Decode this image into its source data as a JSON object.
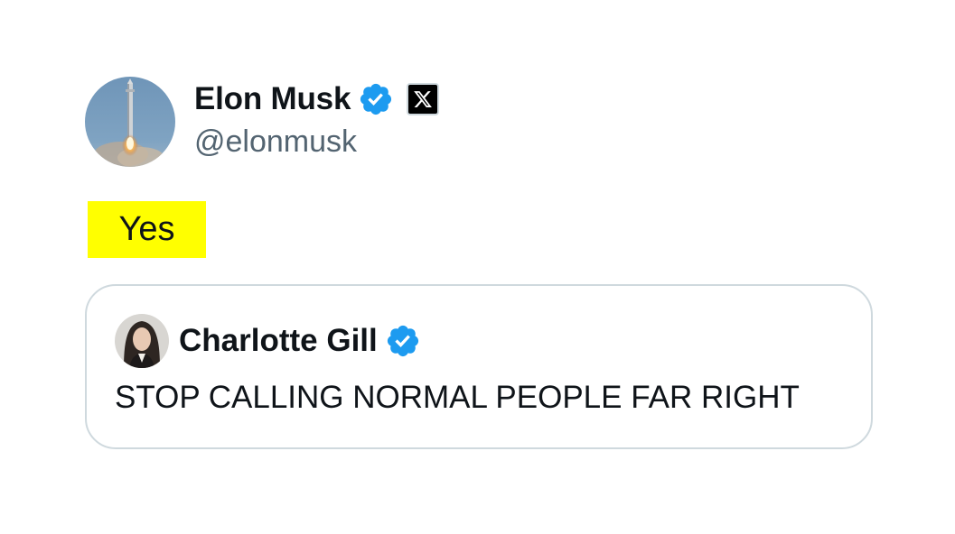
{
  "tweet": {
    "author": {
      "name": "Elon Musk",
      "handle": "@elonmusk",
      "avatar_icon": "rocket-launch-avatar",
      "verified_icon": "verified-badge-icon",
      "affiliation_icon": "x-logo-icon"
    },
    "text": "Yes",
    "highlight_color": "#ffff00"
  },
  "quote": {
    "author": {
      "name": "Charlotte Gill",
      "avatar_icon": "person-avatar",
      "verified_icon": "verified-badge-icon"
    },
    "text": "STOP CALLING NORMAL PEOPLE FAR RIGHT"
  },
  "colors": {
    "verified_blue": "#1d9bf0",
    "secondary_text": "#536471",
    "border": "#cfd9de",
    "primary_text": "#0f1419"
  }
}
